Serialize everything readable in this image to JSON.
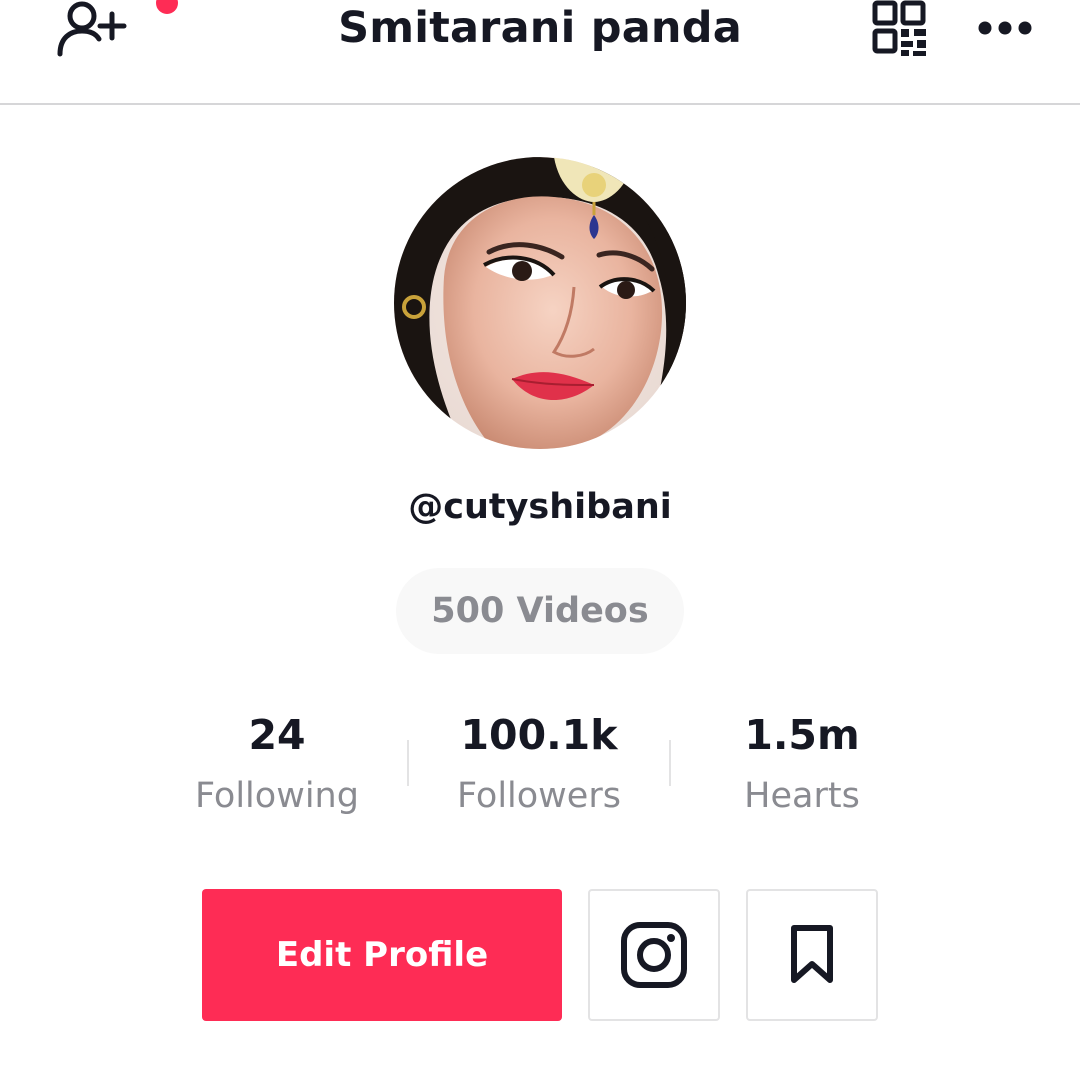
{
  "header": {
    "title": "Smitarani panda",
    "add_friend_icon": "add-user-icon",
    "qr_icon": "qr-code-icon",
    "more_icon": "more-horizontal-icon",
    "notification_color": "#fe2c55"
  },
  "profile": {
    "username": "@cutyshibani",
    "videos_label": "500 Videos"
  },
  "stats": [
    {
      "value": "24",
      "label": "Following"
    },
    {
      "value": "100.1k",
      "label": "Followers"
    },
    {
      "value": "1.5m",
      "label": "Hearts"
    }
  ],
  "actions": {
    "edit_profile_label": "Edit Profile",
    "edit_profile_color": "#fe2c55",
    "instagram_icon": "instagram-icon",
    "bookmark_icon": "bookmark-icon"
  }
}
